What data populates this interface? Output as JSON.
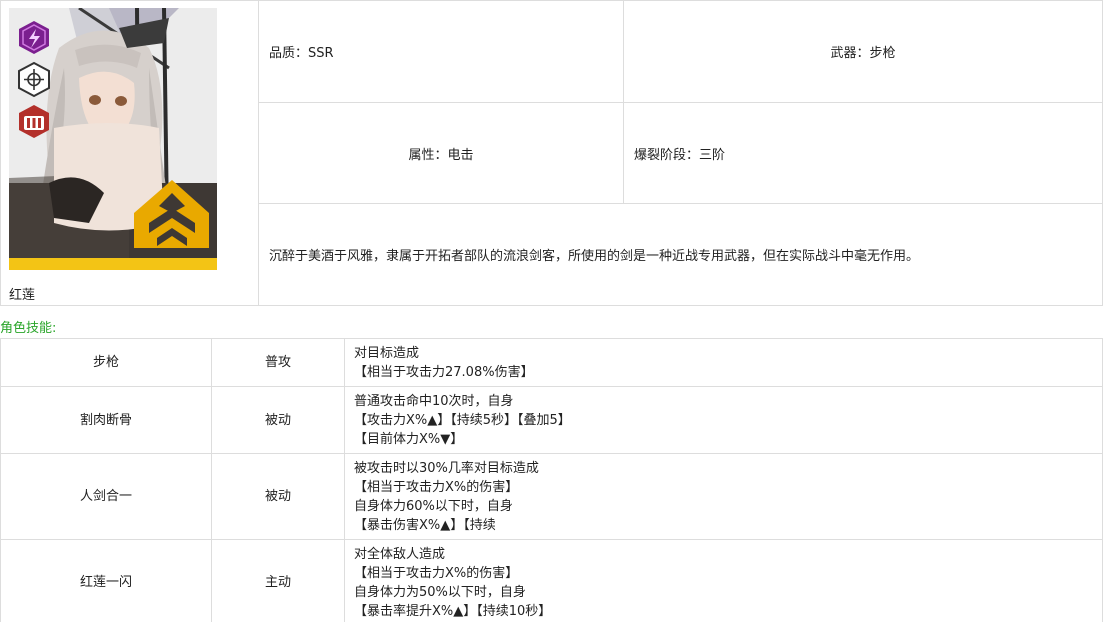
{
  "character": {
    "name": "红莲",
    "icons": [
      "lightning-element-icon",
      "crosshair-weapon-icon",
      "burst-level-three-icon",
      "burst-rank-emblem-icon"
    ],
    "colors": {
      "element_purple": "#7b1f8f",
      "rank_gold": "#e9a900",
      "burst_red": "#b3302b",
      "dark": "#2b2623"
    }
  },
  "info": {
    "quality": "品质：SSR",
    "weapon": "武器：步枪",
    "attribute": "属性：电击",
    "burst_stage": "爆裂阶段：三阶",
    "description": "沉醉于美酒于风雅，隶属于开拓者部队的流浪剑客，所使用的剑是一种近战专用武器，但在实际战斗中毫无作用。"
  },
  "skills_heading": "角色技能:",
  "skills": [
    {
      "name": "步枪",
      "type": "普攻",
      "desc": [
        "对目标造成",
        "【相当于攻击力27.08%伤害】"
      ]
    },
    {
      "name": "割肉断骨",
      "type": "被动",
      "desc": [
        "普通攻击命中10次时，自身",
        "【攻击力X%▲】【持续5秒】【叠加5】",
        "【目前体力X%▼】"
      ]
    },
    {
      "name": "人剑合一",
      "type": "被动",
      "desc": [
        "被攻击时以30%几率对目标造成",
        "【相当于攻击力X%的伤害】",
        "自身体力60%以下时，自身",
        "【暴击伤害X%▲】【持续"
      ]
    },
    {
      "name": "红莲一闪",
      "type": "主动",
      "desc": [
        "对全体敌人造成",
        "【相当于攻击力X%的伤害】",
        "自身体力为50%以下时，自身",
        "【暴击率提升X%▲】【持续10秒】"
      ]
    }
  ]
}
